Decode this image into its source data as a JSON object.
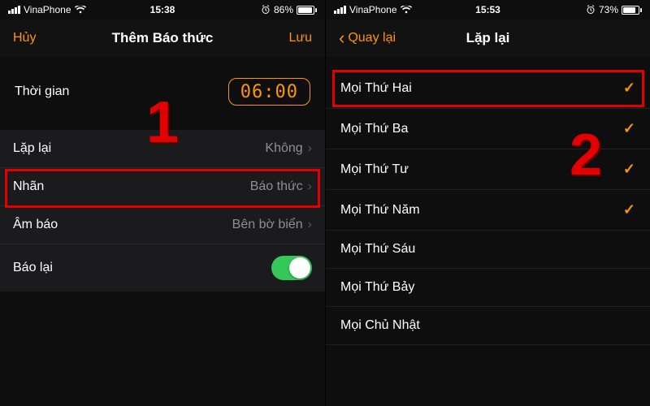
{
  "left": {
    "status": {
      "carrier": "VinaPhone",
      "time": "15:38",
      "battery_pct": "86%",
      "battery_fill": 86
    },
    "nav": {
      "cancel": "Hủy",
      "title": "Thêm Báo thức",
      "save": "Lưu"
    },
    "time_section": {
      "label": "Thời gian",
      "time": "06:00"
    },
    "rows": {
      "repeat": {
        "k": "Lặp lại",
        "v": "Không"
      },
      "label": {
        "k": "Nhãn",
        "v": "Báo thức"
      },
      "sound": {
        "k": "Âm báo",
        "v": "Bên bờ biển"
      },
      "snooze": {
        "k": "Báo lại"
      }
    },
    "annotation_number": "1"
  },
  "right": {
    "status": {
      "carrier": "VinaPhone",
      "time": "15:53",
      "battery_pct": "73%",
      "battery_fill": 73
    },
    "nav": {
      "back": "Quay lại",
      "title": "Lặp lại"
    },
    "days": [
      {
        "label": "Mọi Thứ Hai",
        "checked": true
      },
      {
        "label": "Mọi Thứ Ba",
        "checked": true
      },
      {
        "label": "Mọi Thứ Tư",
        "checked": true
      },
      {
        "label": "Mọi Thứ Năm",
        "checked": true
      },
      {
        "label": "Mọi Thứ Sáu",
        "checked": false
      },
      {
        "label": "Mọi Thứ Bảy",
        "checked": false
      },
      {
        "label": "Mọi Chủ Nhật",
        "checked": false
      }
    ],
    "annotation_number": "2"
  },
  "colors": {
    "accent": "#ff9500",
    "annotation": "#e40000",
    "switch_on": "#34c759"
  }
}
